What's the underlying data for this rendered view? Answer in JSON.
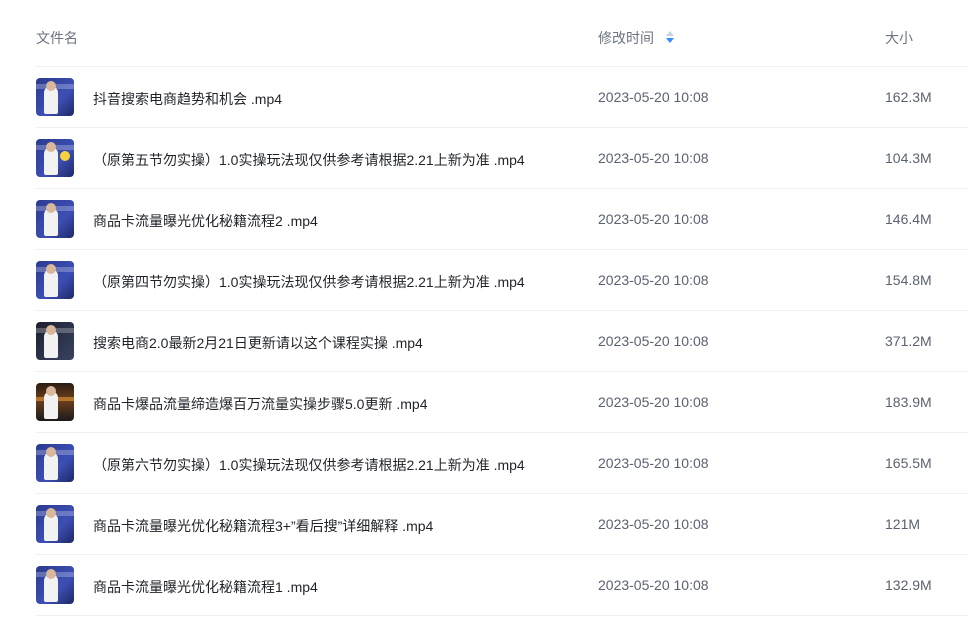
{
  "header": {
    "name": "文件名",
    "modified": "修改时间",
    "size": "大小"
  },
  "files": [
    {
      "name": "抖音搜索电商趋势和机会 .mp4",
      "modified": "2023-05-20 10:08",
      "size": "162.3M",
      "thumb": "video-thumbnail"
    },
    {
      "name": "（原第五节勿实操）1.0实操玩法现仅供参考请根据2.21上新为准 .mp4",
      "modified": "2023-05-20 10:08",
      "size": "104.3M",
      "thumb": "video-thumbnail"
    },
    {
      "name": "商品卡流量曝光优化秘籍流程2 .mp4",
      "modified": "2023-05-20 10:08",
      "size": "146.4M",
      "thumb": "video-thumbnail"
    },
    {
      "name": "（原第四节勿实操）1.0实操玩法现仅供参考请根据2.21上新为准 .mp4",
      "modified": "2023-05-20 10:08",
      "size": "154.8M",
      "thumb": "video-thumbnail"
    },
    {
      "name": "搜索电商2.0最新2月21日更新请以这个课程实操 .mp4",
      "modified": "2023-05-20 10:08",
      "size": "371.2M",
      "thumb": "video-thumbnail"
    },
    {
      "name": "商品卡爆品流量缔造爆百万流量实操步骤5.0更新 .mp4",
      "modified": "2023-05-20 10:08",
      "size": "183.9M",
      "thumb": "video-thumbnail"
    },
    {
      "name": "（原第六节勿实操）1.0实操玩法现仅供参考请根据2.21上新为准 .mp4",
      "modified": "2023-05-20 10:08",
      "size": "165.5M",
      "thumb": "video-thumbnail"
    },
    {
      "name": "商品卡流量曝光优化秘籍流程3+”看后搜”详细解释 .mp4",
      "modified": "2023-05-20 10:08",
      "size": "121M",
      "thumb": "video-thumbnail"
    },
    {
      "name": "商品卡流量曝光优化秘籍流程1 .mp4",
      "modified": "2023-05-20 10:08",
      "size": "132.9M",
      "thumb": "video-thumbnail"
    }
  ],
  "colors": {
    "header_text": "#6b7380",
    "row_text": "#1f2329",
    "meta_text": "#5a6270",
    "divider": "#eef0f3",
    "sort_active": "#2f8fff"
  },
  "icons": {
    "sort": "sort-desc-icon"
  }
}
